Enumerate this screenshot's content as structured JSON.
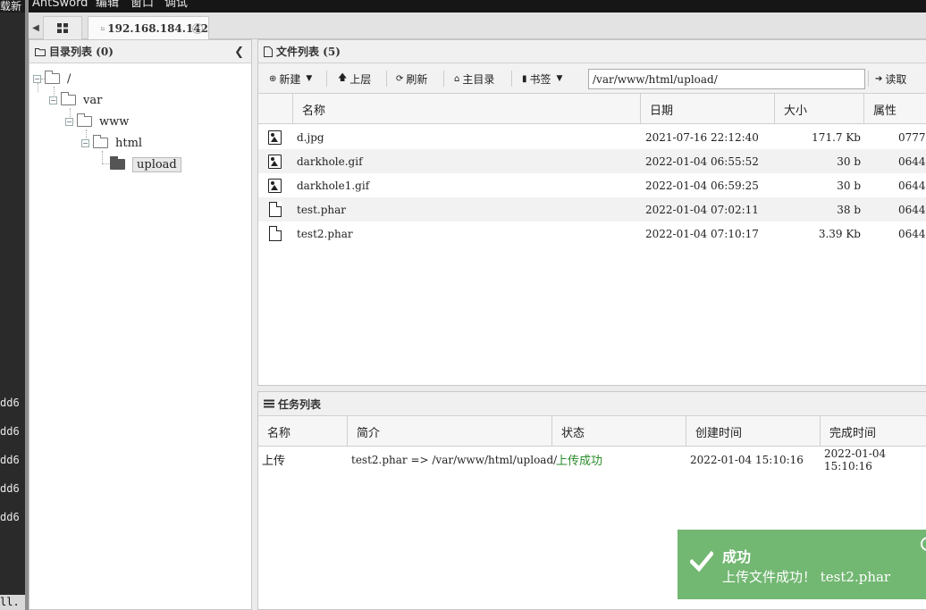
{
  "background_terminal": {
    "header_text": "载新",
    "lines": [
      "dd6",
      "dd6",
      "dd6",
      "dd6",
      "dd6"
    ],
    "bottom_text": "ll."
  },
  "menubar": {
    "items": [
      "AntSword",
      "编辑",
      "窗口",
      "调试"
    ]
  },
  "tabs": {
    "home_icon": "grid-icon",
    "host_tab_label": "192.168.184.142"
  },
  "dir_panel": {
    "title": "目录列表 (0)",
    "tree": [
      {
        "label": "/",
        "depth": 0
      },
      {
        "label": "var",
        "depth": 1
      },
      {
        "label": "www",
        "depth": 2
      },
      {
        "label": "html",
        "depth": 3
      },
      {
        "label": "upload",
        "depth": 4,
        "selected": true
      }
    ]
  },
  "file_panel": {
    "title": "文件列表 (5)",
    "toolbar": {
      "new": "新建",
      "up": "上层",
      "refresh": "刷新",
      "home": "主目录",
      "bookmark": "书签",
      "path": "/var/www/html/upload/",
      "read": "读取"
    },
    "columns": [
      "名称",
      "日期",
      "大小",
      "属性"
    ],
    "files": [
      {
        "name": "d.jpg",
        "date": "2021-07-16 22:12:40",
        "size": "171.7 Kb",
        "attr": "0777",
        "type": "image"
      },
      {
        "name": "darkhole.gif",
        "date": "2022-01-04 06:55:52",
        "size": "30 b",
        "attr": "0644",
        "type": "image"
      },
      {
        "name": "darkhole1.gif",
        "date": "2022-01-04 06:59:25",
        "size": "30 b",
        "attr": "0644",
        "type": "image"
      },
      {
        "name": "test.phar",
        "date": "2022-01-04 07:02:11",
        "size": "38 b",
        "attr": "0644",
        "type": "file"
      },
      {
        "name": "test2.phar",
        "date": "2022-01-04 07:10:17",
        "size": "3.39 Kb",
        "attr": "0644",
        "type": "file"
      }
    ]
  },
  "task_panel": {
    "title": "任务列表",
    "columns": [
      "名称",
      "简介",
      "状态",
      "创建时间",
      "完成时间"
    ],
    "tasks": [
      {
        "name": "上传",
        "desc": "test2.phar => /var/www/html/upload/",
        "status": "上传成功",
        "created": "2022-01-04 15:10:16",
        "finished": "2022-01-04 15:10:16"
      }
    ]
  },
  "toast": {
    "title": "成功",
    "message": "上传文件成功！ test2.phar",
    "color": "#72b772"
  }
}
